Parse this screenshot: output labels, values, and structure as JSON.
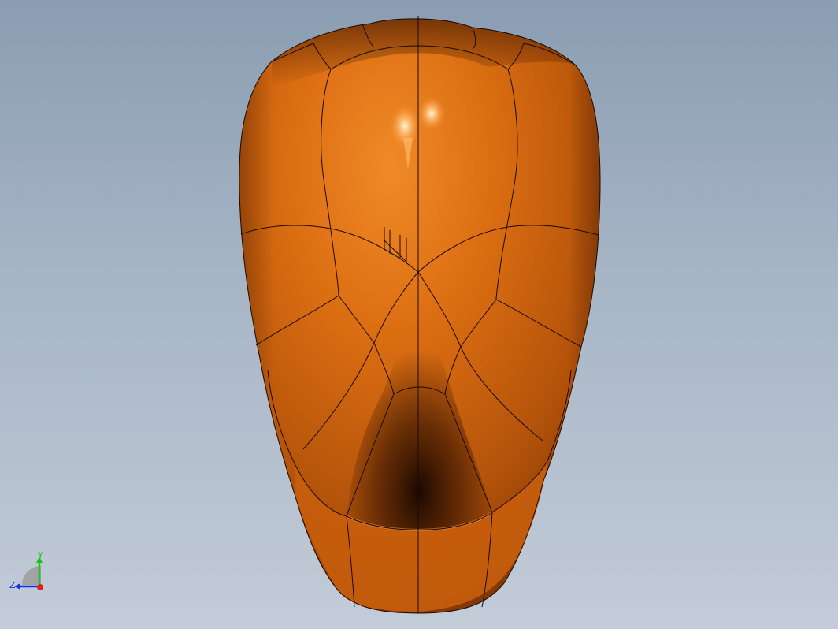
{
  "viewport": {
    "part_color": "#d86a10"
  },
  "triad": {
    "y_label": "Y",
    "z_label": "Z",
    "y_color": "#19c619",
    "z_color": "#1530e0",
    "x_color": "#e02020"
  }
}
